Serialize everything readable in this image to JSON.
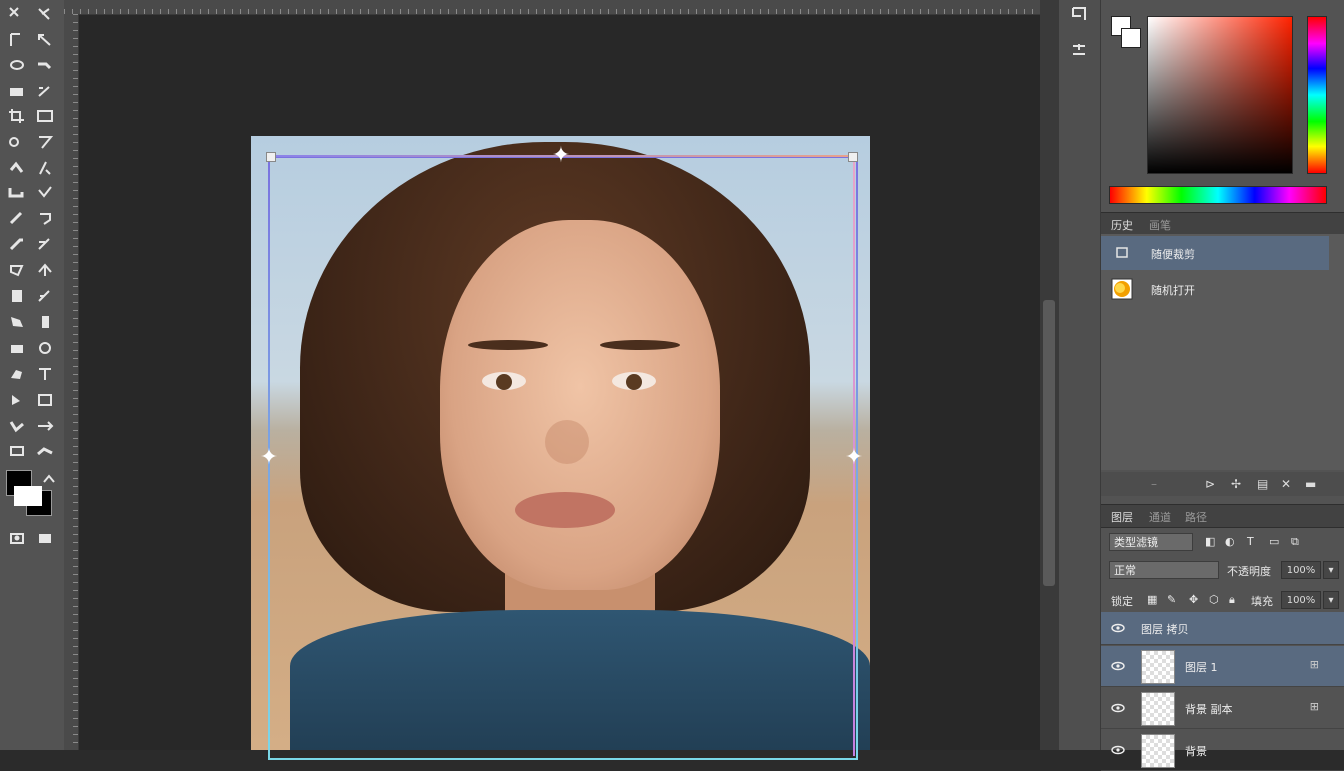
{
  "toolbox": {
    "tools": [
      "move-tool",
      "marquee-tool",
      "lasso-tool",
      "magic-wand-tool",
      "crop-tool",
      "eyedropper-tool",
      "healing-brush-tool",
      "brush-tool",
      "clone-stamp-tool",
      "history-brush-tool",
      "eraser-tool",
      "gradient-tool",
      "blur-tool",
      "dodge-tool",
      "pen-tool",
      "type-tool",
      "path-selection-tool",
      "shape-tool",
      "hand-tool",
      "zoom-tool"
    ]
  },
  "right_strip": {
    "buttons": [
      "history-panel-icon",
      "actions-panel-icon"
    ]
  },
  "history_panel": {
    "tabs": [
      "历史",
      "画笔"
    ],
    "items": [
      {
        "label": "随便裁剪",
        "selected": true,
        "icon": "document-icon"
      },
      {
        "label": "随机打开",
        "selected": false,
        "icon": "snapshot-icon"
      }
    ]
  },
  "layers_panel": {
    "tabs": [
      "图层",
      "通道",
      "路径"
    ],
    "kind_label": "类型滤镜",
    "blend_mode": "正常",
    "opacity_label": "不透明度",
    "opacity_value": "100%",
    "lock_label": "锁定",
    "fill_label": "填充",
    "fill_value": "100%",
    "layers": [
      {
        "name": "图层 拷贝",
        "selected": true,
        "thumb": false
      },
      {
        "name": "图层 1",
        "selected": true,
        "thumb": true,
        "badge": "⊞"
      },
      {
        "name": "背景 副本",
        "selected": false,
        "thumb": true,
        "badge": "⊞"
      },
      {
        "name": "背景",
        "selected": false,
        "thumb": true,
        "badge": ""
      }
    ]
  },
  "colors": {
    "accent_selection": "#596a80",
    "panel_bg": "#535353",
    "canvas_bg": "#282828"
  }
}
